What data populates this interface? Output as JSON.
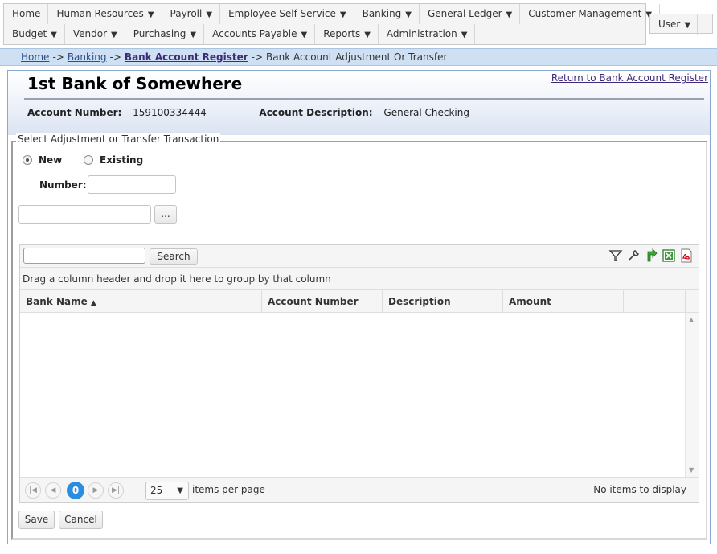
{
  "menu": {
    "row1": [
      {
        "label": "Home",
        "has_arrow": false
      },
      {
        "label": "Human Resources",
        "has_arrow": true
      },
      {
        "label": "Payroll",
        "has_arrow": true
      },
      {
        "label": "Employee Self-Service",
        "has_arrow": true
      },
      {
        "label": "Banking",
        "has_arrow": true
      },
      {
        "label": "General Ledger",
        "has_arrow": true
      },
      {
        "label": "Customer Management",
        "has_arrow": true
      }
    ],
    "row2": [
      {
        "label": "Budget",
        "has_arrow": true
      },
      {
        "label": "Vendor",
        "has_arrow": true
      },
      {
        "label": "Purchasing",
        "has_arrow": true
      },
      {
        "label": "Accounts Payable",
        "has_arrow": true
      },
      {
        "label": "Reports",
        "has_arrow": true
      },
      {
        "label": "Administration",
        "has_arrow": true
      }
    ],
    "user_label": "User",
    "arrow_glyph": "▼"
  },
  "breadcrumb": {
    "home": "Home",
    "banking": "Banking",
    "register": "Bank Account Register",
    "current": "Bank Account Adjustment Or Transfer",
    "separator": "->"
  },
  "header": {
    "bank_name": "1st Bank of Somewhere",
    "return_link": "Return to Bank Account Register",
    "account_number_label": "Account Number:",
    "account_number": "159100334444",
    "account_description_label": "Account Description:",
    "account_description": "General Checking"
  },
  "form": {
    "legend": "Select Adjustment or Transfer Transaction",
    "radio_new": "New",
    "radio_existing": "Existing",
    "selected": "new",
    "number_label": "Number:",
    "number_value": "",
    "lookup_value": "",
    "lookup_button": "..."
  },
  "grid": {
    "search_button": "Search",
    "search_value": "",
    "group_hint": "Drag a column header and drop it here to group by that column",
    "columns": [
      "Bank Name",
      "Account Number",
      "Description",
      "Amount",
      ""
    ],
    "sort_indicator": "▲",
    "rows": [],
    "pager": {
      "current_page": "0",
      "page_size": "25",
      "items_per_page_label": "items per page",
      "status": "No items to display"
    },
    "toolbar_icons": [
      "filter-icon",
      "wrench-icon",
      "refresh-icon",
      "excel-icon",
      "pdf-icon"
    ]
  },
  "actions": {
    "save": "Save",
    "cancel": "Cancel"
  }
}
